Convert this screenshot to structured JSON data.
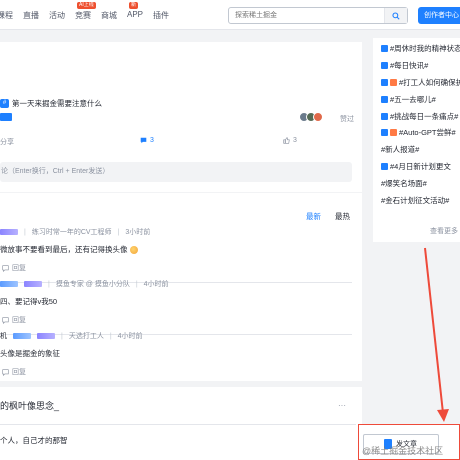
{
  "header": {
    "nav": [
      {
        "label": "课程"
      },
      {
        "label": "直播"
      },
      {
        "label": "活动"
      },
      {
        "label": "竞赛",
        "badge": "AI上线"
      },
      {
        "label": "商城"
      },
      {
        "label": "APP",
        "badge": "新"
      },
      {
        "label": "插件"
      }
    ],
    "search_placeholder": "探索稀土掘金",
    "create_label": "创作者中心"
  },
  "article": {
    "title": "第一天来掘金需要注意什么",
    "liked_label": "赞过",
    "share_label": "分享",
    "comment_count": "3",
    "like_count": "3"
  },
  "comment_input": {
    "placeholder": "论（Enter换行，Ctrl + Enter发送）"
  },
  "comments": {
    "sort_latest": "最新",
    "sort_hot": "最热",
    "items": [
      {
        "role": "练习时常一年的CV工程师",
        "time": "3小时前",
        "text": "微放事不要看到最后，还有记得换头像",
        "reply": "回复"
      },
      {
        "role": "摸鱼专家 @ 摸鱼小分队",
        "time": "4小时前",
        "text": "四、要记得v我50",
        "reply": "回复"
      },
      {
        "user": "机",
        "role": "天选打工人",
        "time": "4小时前",
        "text": "头像是掘金的象征",
        "reply": "回复"
      }
    ]
  },
  "next_card": {
    "author": "的枫叶像思念_",
    "more": "···",
    "sub": "个人，自己才的那智"
  },
  "sidebar": {
    "tags": [
      {
        "label": "#周休时我的精神状态",
        "icons": [
          "blue"
        ]
      },
      {
        "label": "#每日快讯#",
        "icons": [
          "blue"
        ]
      },
      {
        "label": "#打工人如何确保护眼#",
        "icons": [
          "blue",
          "orange"
        ]
      },
      {
        "label": "#五一去哪儿#",
        "icons": [
          "blue"
        ]
      },
      {
        "label": "#挑战每日一条痛点#",
        "icons": [
          "blue"
        ]
      },
      {
        "label": "#Auto-GPT尝鲜#",
        "icons": [
          "blue",
          "orange"
        ]
      },
      {
        "label": "#新人报道#",
        "icons": []
      },
      {
        "label": "#4月日新计划更文",
        "icons": [
          "blue"
        ]
      },
      {
        "label": "#爆笑名场面#",
        "icons": []
      },
      {
        "label": "#金石计划征文活动#",
        "icons": []
      }
    ],
    "more_label": "查看更多 >"
  },
  "floating": {
    "publish_label": "发文章",
    "watermark": "@稀土掘金技术社区"
  },
  "colors": {
    "accent": "#1e80ff",
    "annotation": "#ee4a3a"
  }
}
